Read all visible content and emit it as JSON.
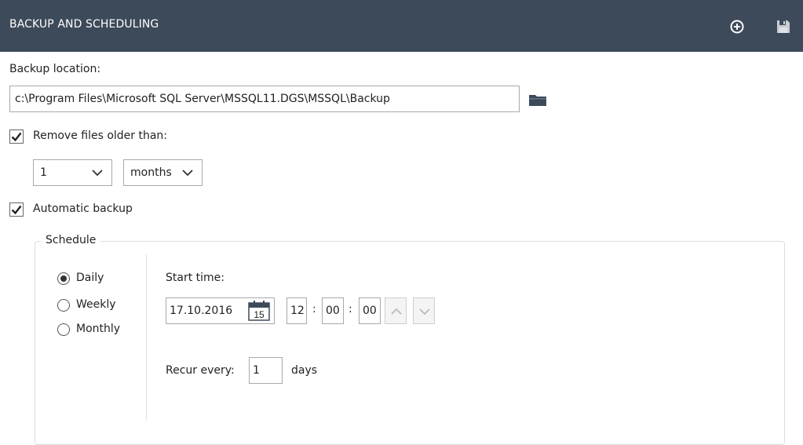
{
  "header": {
    "title": "BACKUP AND SCHEDULING",
    "add_icon": "plus-circle-icon",
    "save_icon": "floppy-disk-icon"
  },
  "backup_location": {
    "label": "Backup location:",
    "value": "c:\\Program Files\\Microsoft SQL Server\\MSSQL11.DGS\\MSSQL\\Backup",
    "browse_icon": "folder-icon"
  },
  "remove_files": {
    "checked": true,
    "label": "Remove files older than:",
    "amount": "1",
    "unit": "months"
  },
  "automatic_backup": {
    "checked": true,
    "label": "Automatic backup"
  },
  "schedule": {
    "legend": "Schedule",
    "frequency_options": [
      {
        "label": "Daily",
        "selected": true
      },
      {
        "label": "Weekly",
        "selected": false
      },
      {
        "label": "Monthly",
        "selected": false
      }
    ],
    "start_time_label": "Start time:",
    "start_date": "17.10.2016",
    "calendar_day": "15",
    "hour": "12",
    "minute": "00",
    "second": "00",
    "time_separator": ":",
    "recur_label": "Recur every:",
    "recur_value": "1",
    "recur_unit": "days"
  },
  "colors": {
    "header_bg": "#3d4a5a",
    "header_text": "#ffffff",
    "border": "#a9a9a9"
  }
}
